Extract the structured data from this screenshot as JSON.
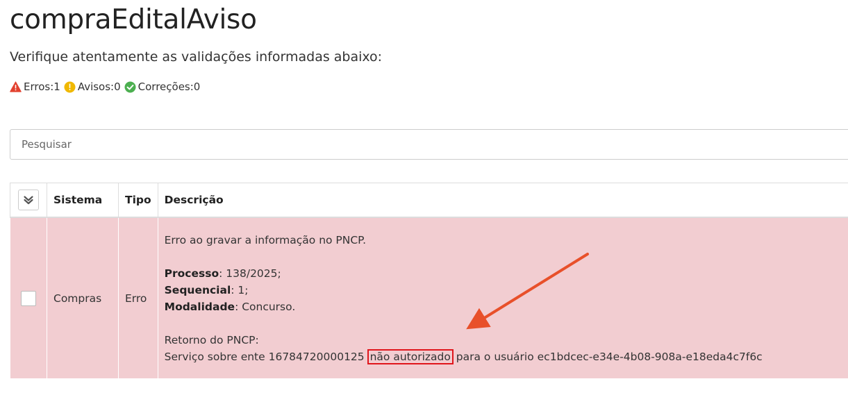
{
  "page": {
    "title": "compraEditalAviso",
    "subtitle": "Verifique atentamente as validações informadas abaixo:"
  },
  "counters": {
    "errors_label": "Erros:1",
    "warnings_label": "Avisos:0",
    "corrections_label": "Correções:0",
    "colors": {
      "error": "#e2412f",
      "warning": "#f0b800",
      "correction": "#4caf50"
    }
  },
  "search": {
    "placeholder": "Pesquisar",
    "value": ""
  },
  "table": {
    "columns": [
      "Sistema",
      "Tipo",
      "Descrição"
    ],
    "rows": [
      {
        "sistema": "Compras",
        "tipo": "Erro",
        "checked": false,
        "description": {
          "message": "Erro ao gravar a informação no PNCP.",
          "fields": [
            {
              "label": "Processo",
              "value": ": 138/2025;"
            },
            {
              "label": "Sequencial",
              "value": ": 1;"
            },
            {
              "label": "Modalidade",
              "value": ": Concurso."
            }
          ],
          "return_title": "Retorno do PNCP:",
          "return_prefix": "Serviço sobre ente 16784720000125",
          "return_highlight": "não autorizado",
          "return_suffix": "para o usuário ec1bdcec-e34e-4b08-908a-e18eda4c7f6c"
        }
      }
    ],
    "row_color": "#f2cdd1"
  },
  "annotation": {
    "arrow_color": "#e8502a",
    "highlight_color": "#e0161c"
  }
}
